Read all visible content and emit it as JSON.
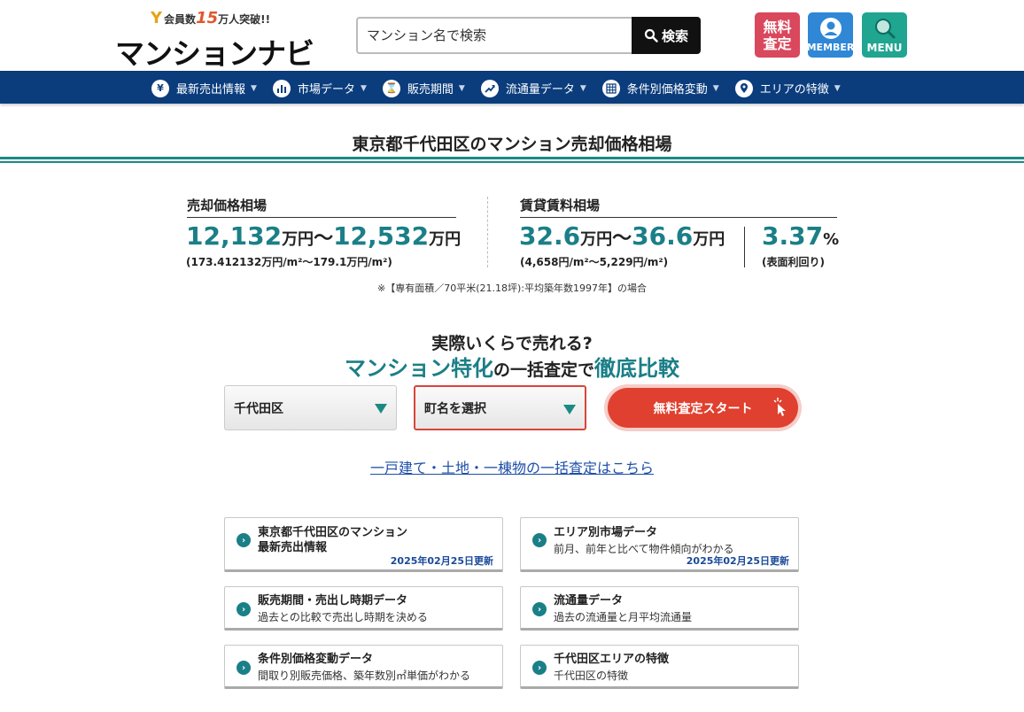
{
  "header": {
    "logo_badge_prefix": "会員数",
    "logo_badge_number": "15",
    "logo_badge_suffix": "万人突破!!",
    "logo_text": "マンションナビ",
    "search_placeholder": "マンション名で検索",
    "search_button": "検索",
    "free_assess_line1": "無料",
    "free_assess_line2": "査定",
    "member_label": "MEMBER",
    "menu_label": "MENU"
  },
  "nav": {
    "items": [
      {
        "label": "最新売出情報",
        "icon": "yen-icon"
      },
      {
        "label": "市場データ",
        "icon": "bar-chart-icon"
      },
      {
        "label": "販売期間",
        "icon": "hourglass-icon"
      },
      {
        "label": "流通量データ",
        "icon": "trend-up-icon"
      },
      {
        "label": "条件別価格変動",
        "icon": "grid-icon"
      },
      {
        "label": "エリアの特徴",
        "icon": "map-pin-icon"
      }
    ]
  },
  "page_title": "東京都千代田区のマンション売却価格相場",
  "sale": {
    "label": "売却価格相場",
    "min": "12,132",
    "max": "12,532",
    "unit": "万円",
    "tilde": "〜",
    "per_m2": "(173.412132万円/m²〜179.1万円/m²)"
  },
  "rent": {
    "label": "賃貸賃料相場",
    "min": "32.6",
    "max": "36.6",
    "unit": "万円",
    "tilde": "〜",
    "per_m2": "(4,658円/m²〜5,229円/m²)"
  },
  "yield": {
    "value": "3.37",
    "unit": "%",
    "label": "(表面利回り)"
  },
  "footnote": "※【専有面積／70平米(21.18坪):平均築年数1997年】の場合",
  "cta": {
    "line1": "実際いくらで売れる?",
    "part1": "マンション特化",
    "part2": "の一括査定で",
    "part3": "徹底比較"
  },
  "form": {
    "city_selected": "千代田区",
    "town_placeholder": "町名を選択",
    "start_button": "無料査定スタート"
  },
  "other_link": "一戸建て・土地・一棟物の一括査定はこちら",
  "cards": [
    {
      "title1": "東京都千代田区のマンション",
      "title2": "最新売出情報",
      "date": "2025年02月25日更新"
    },
    {
      "title": "エリア別市場データ",
      "sub": "前月、前年と比べて物件傾向がわかる",
      "date": "2025年02月25日更新"
    },
    {
      "title": "販売期間・売出し時期データ",
      "sub": "過去との比較で売出し時期を決める"
    },
    {
      "title": "流通量データ",
      "sub": "過去の流通量と月平均流通量"
    },
    {
      "title": "条件別価格変動データ",
      "sub": "間取り別販売価格、築年数別㎡単価がわかる"
    },
    {
      "title": "千代田区エリアの特徴",
      "sub": "千代田区の特徴"
    }
  ]
}
